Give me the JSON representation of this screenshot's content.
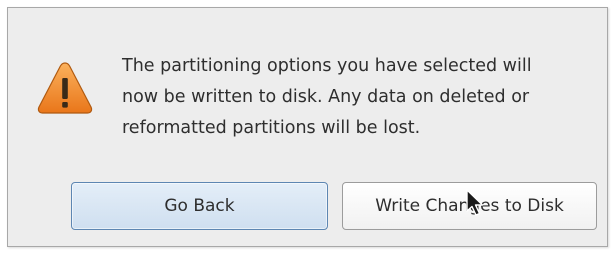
{
  "dialog": {
    "message_lines": [
      "The partitioning options you have selected will",
      "now be written to disk.  Any data on deleted or",
      "reformatted partitions will be lost."
    ],
    "icon": "warning-icon",
    "buttons": {
      "go_back": "Go Back",
      "write_changes": "Write Changes to Disk"
    }
  },
  "colors": {
    "warning_fill": "#f08a24",
    "accent_border": "#5d86b2",
    "dialog_background": "#ededed"
  },
  "cursor": "arrow-cursor"
}
